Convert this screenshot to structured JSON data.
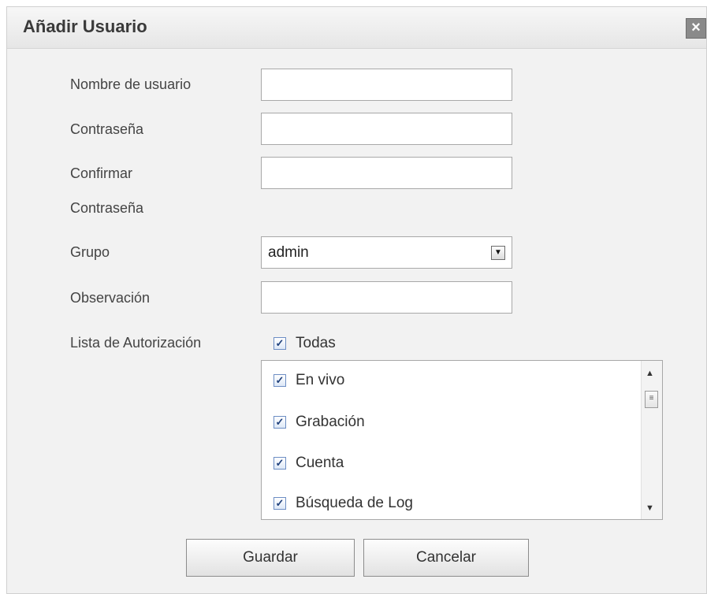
{
  "dialog": {
    "title": "Añadir Usuario",
    "close_glyph": "×",
    "close_icon": "close-icon"
  },
  "form": {
    "username": {
      "label": "Nombre de usuario",
      "value": "",
      "placeholder": ""
    },
    "password": {
      "label": "Contraseña",
      "value": "",
      "placeholder": ""
    },
    "confirm_password": {
      "label_line1": "Confirmar",
      "label_line2": "Contraseña",
      "value": "",
      "placeholder": ""
    },
    "group": {
      "label": "Grupo",
      "selected": "admin",
      "arrow_glyph": "▼",
      "arrow_icon": "chevron-down-icon"
    },
    "observation": {
      "label": "Observación",
      "value": "",
      "placeholder": ""
    },
    "authorization": {
      "label": "Lista de Autorización",
      "all": {
        "label": "Todas",
        "checked": true
      },
      "items": [
        {
          "label": "En vivo",
          "checked": true
        },
        {
          "label": "Grabación",
          "checked": true
        },
        {
          "label": "Cuenta",
          "checked": true
        },
        {
          "label": "Búsqueda de Log",
          "checked": true
        }
      ],
      "scroll_up_glyph": "▲",
      "scroll_down_glyph": "▼",
      "scroll_thumb_glyph": "≡"
    }
  },
  "buttons": {
    "save": "Guardar",
    "cancel": "Cancelar"
  },
  "check_glyph": "✓",
  "colors": {
    "dialog_bg": "#f2f2f2",
    "checkbox_border": "#6d8ec4",
    "close_button": "#8a8a8a"
  }
}
